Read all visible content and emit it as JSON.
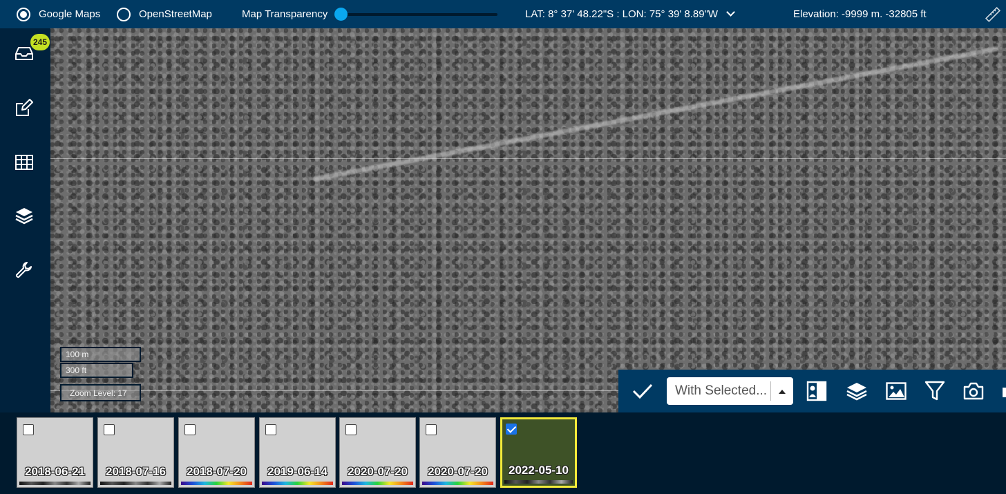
{
  "topbar": {
    "basemap_options": [
      {
        "label": "Google Maps",
        "selected": true
      },
      {
        "label": "OpenStreetMap",
        "selected": false
      }
    ],
    "transparency_label": "Map Transparency",
    "transparency_value": 0.0,
    "coordinates": "LAT: 8° 37' 48.22\"S : LON: 75° 39' 8.89\"W",
    "elevation": "Elevation: -9999 m. -32805 ft",
    "ruler_icon": "ruler-icon"
  },
  "sidebar": {
    "inbox_badge": "245",
    "items": [
      {
        "icon": "inbox-icon"
      },
      {
        "icon": "edit-icon"
      },
      {
        "icon": "table-icon"
      },
      {
        "icon": "layers-icon"
      },
      {
        "icon": "wrench-icon"
      }
    ]
  },
  "map": {
    "scale_m": "100 m",
    "scale_ft": "300 ft",
    "zoom_level": "Zoom Level: 17"
  },
  "map_toolbar": {
    "with_selected_label": "With Selected...",
    "icons": [
      "check-icon",
      "portrait-icon",
      "layers-icon",
      "image-icon",
      "filter-icon",
      "camera-icon"
    ]
  },
  "thumbnails": [
    {
      "date": "2018-06-21",
      "checked": false,
      "bar": "gray"
    },
    {
      "date": "2018-07-16",
      "checked": false,
      "bar": "gray"
    },
    {
      "date": "2018-07-20",
      "checked": false,
      "bar": "rainbow"
    },
    {
      "date": "2019-06-14",
      "checked": false,
      "bar": "rainbow"
    },
    {
      "date": "2020-07-20",
      "checked": false,
      "bar": "rainbow"
    },
    {
      "date": "2020-07-20",
      "checked": false,
      "bar": "rainbow"
    },
    {
      "date": "2022-05-10",
      "checked": true,
      "bar": "gray"
    }
  ],
  "colors": {
    "topbar_bg": "#003a63",
    "sidebar_bg": "#00223d",
    "accent": "#0aa8f0",
    "badge": "#c4e023",
    "selected_border": "#f2ea3a"
  }
}
